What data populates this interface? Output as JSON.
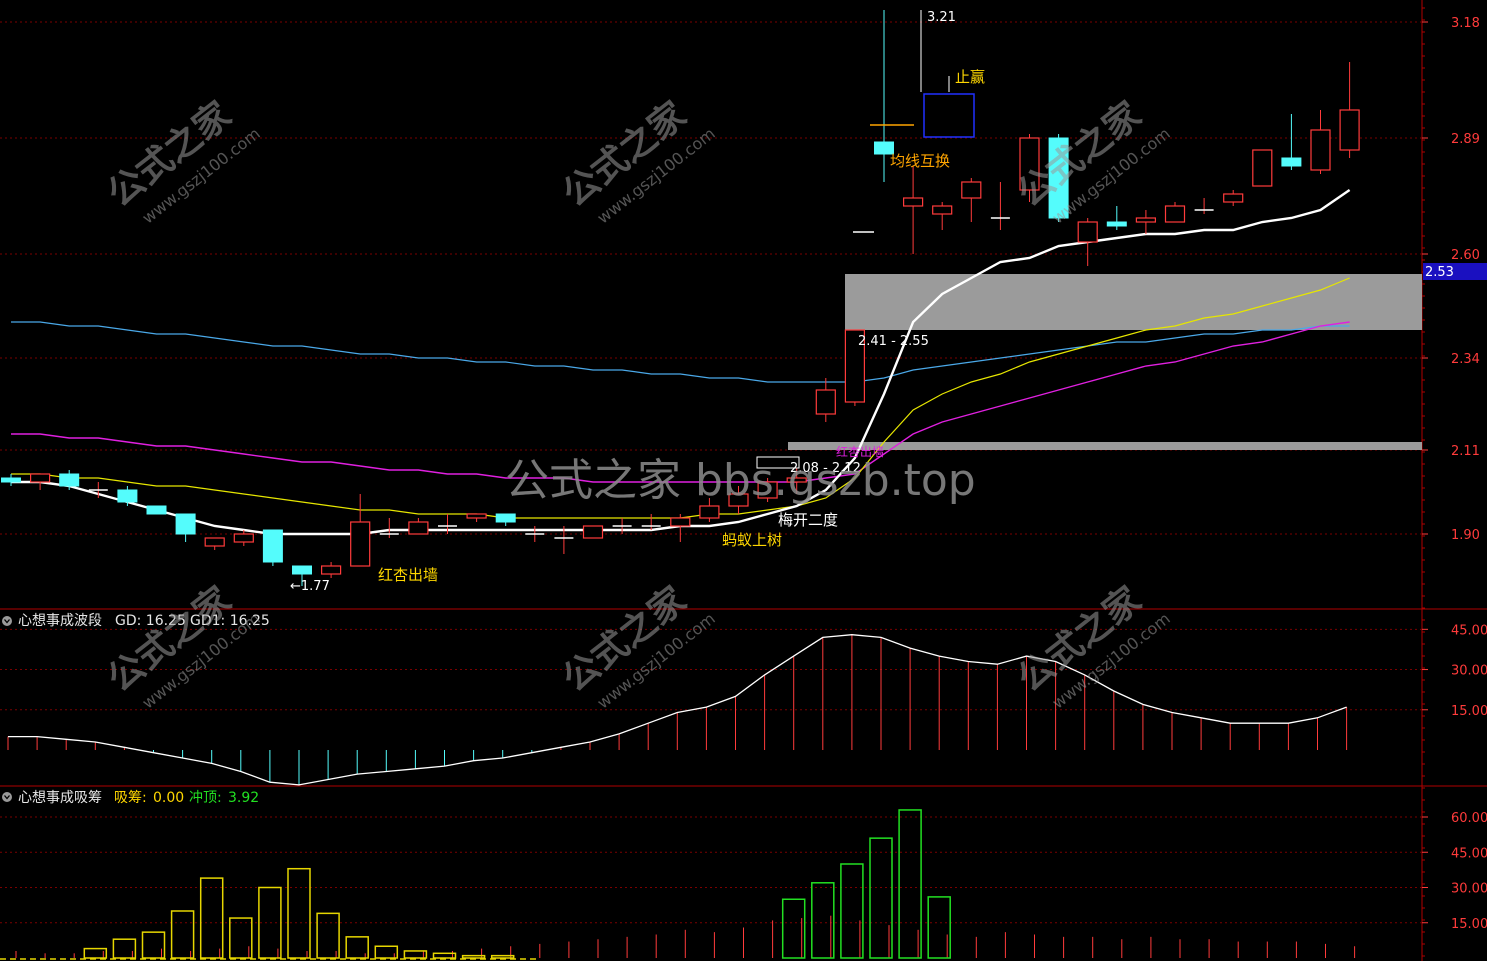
{
  "colors": {
    "background": "#000000",
    "up": "#ff3b3b",
    "down": "#54fcfc",
    "grid": "#7a0000",
    "frame": "#b00000",
    "axis_text": "#ff3b3b",
    "ma_fast": "#ffffff",
    "ma_yellow": "#e6e600",
    "ma_magenta": "#e020e0",
    "ma_blue": "#4aa8e8",
    "zone": "#a8a8a8",
    "yellow_label": "#ffd700",
    "orange_label": "#ffa500",
    "gd_line": "#ffffff",
    "wave_up": "#ff3b3b",
    "wave_down": "#54fcfc",
    "xc_bar": "#e6d600",
    "ct_bar": "#22e022",
    "sub_red": "#ff3b3b",
    "price_tag_bg": "#1a10c0"
  },
  "watermarks": {
    "center": "公式之家 bbs.gszb.top",
    "stamp_cn": "公式之家",
    "stamp_url": "www.gszj100.com"
  },
  "main_panel": {
    "price_axis_ticks": [
      "3.18",
      "2.89",
      "2.60",
      "2.34",
      "2.11",
      "1.90"
    ],
    "current_price_tag": "2.53",
    "annotations": {
      "high": "3.21",
      "low": "←1.77",
      "zone_upper": "2.41 - 2.55",
      "zone_lower": "2.08 - 2.12",
      "hong_xing": "红杏出墙",
      "ma_yi": "蚂蚁上树",
      "mei_kai": "梅开二度",
      "jun_xian": "均线互换",
      "zhi_ying": "止赢",
      "magenta_small": "红杏出墙"
    }
  },
  "wave_panel": {
    "title": "心想事成波段",
    "gd_label": "GD: 16.25",
    "gd1_label": "GD1: 16.25",
    "axis_ticks": [
      "45.00",
      "30.00",
      "15.00"
    ]
  },
  "xichou_panel": {
    "title": "心想事成吸筹",
    "xc_label": "吸筹:",
    "xc_value": "0.00",
    "ct_label": "冲顶:",
    "ct_value": "3.92",
    "axis_ticks": [
      "60.00",
      "45.00",
      "30.00",
      "15.00"
    ]
  },
  "chart_data": [
    {
      "type": "candlestick",
      "y_axis_ticks": [
        3.18,
        2.89,
        2.6,
        2.34,
        2.11,
        1.9
      ],
      "ylim": [
        1.73,
        3.27
      ],
      "candles": [
        {
          "o": 2.04,
          "h": 2.05,
          "l": 2.02,
          "c": 2.03
        },
        {
          "o": 2.03,
          "h": 2.05,
          "l": 2.01,
          "c": 2.05
        },
        {
          "o": 2.05,
          "h": 2.06,
          "l": 2.01,
          "c": 2.02
        },
        {
          "o": 2.01,
          "h": 2.03,
          "l": 1.99,
          "c": 2.01
        },
        {
          "o": 2.01,
          "h": 2.02,
          "l": 1.97,
          "c": 1.98
        },
        {
          "o": 1.97,
          "h": 1.97,
          "l": 1.95,
          "c": 1.95
        },
        {
          "o": 1.95,
          "h": 1.95,
          "l": 1.88,
          "c": 1.9
        },
        {
          "o": 1.87,
          "h": 1.89,
          "l": 1.86,
          "c": 1.89
        },
        {
          "o": 1.88,
          "h": 1.91,
          "l": 1.87,
          "c": 1.9
        },
        {
          "o": 1.91,
          "h": 1.91,
          "l": 1.82,
          "c": 1.83
        },
        {
          "o": 1.82,
          "h": 1.82,
          "l": 1.77,
          "c": 1.8
        },
        {
          "o": 1.8,
          "h": 1.83,
          "l": 1.79,
          "c": 1.82
        },
        {
          "o": 1.82,
          "h": 2.0,
          "l": 1.82,
          "c": 1.93
        },
        {
          "o": 1.9,
          "h": 1.94,
          "l": 1.89,
          "c": 1.9
        },
        {
          "o": 1.9,
          "h": 1.94,
          "l": 1.9,
          "c": 1.93
        },
        {
          "o": 1.92,
          "h": 1.95,
          "l": 1.9,
          "c": 1.92
        },
        {
          "o": 1.94,
          "h": 1.95,
          "l": 1.93,
          "c": 1.95
        },
        {
          "o": 1.95,
          "h": 1.95,
          "l": 1.92,
          "c": 1.93
        },
        {
          "o": 1.9,
          "h": 1.92,
          "l": 1.88,
          "c": 1.9
        },
        {
          "o": 1.89,
          "h": 1.92,
          "l": 1.85,
          "c": 1.89
        },
        {
          "o": 1.89,
          "h": 1.92,
          "l": 1.89,
          "c": 1.92
        },
        {
          "o": 1.92,
          "h": 1.94,
          "l": 1.9,
          "c": 1.92
        },
        {
          "o": 1.92,
          "h": 1.95,
          "l": 1.91,
          "c": 1.92
        },
        {
          "o": 1.92,
          "h": 1.95,
          "l": 1.88,
          "c": 1.94
        },
        {
          "o": 1.94,
          "h": 1.99,
          "l": 1.93,
          "c": 1.97
        },
        {
          "o": 1.97,
          "h": 2.02,
          "l": 1.95,
          "c": 2.0
        },
        {
          "o": 1.99,
          "h": 2.04,
          "l": 1.98,
          "c": 2.03
        },
        {
          "o": 2.03,
          "h": 2.07,
          "l": 2.0,
          "c": 2.04
        },
        {
          "o": 2.2,
          "h": 2.29,
          "l": 2.18,
          "c": 2.26
        },
        {
          "o": 2.23,
          "h": 2.41,
          "l": 2.22,
          "c": 2.41
        },
        {
          "o": 2.88,
          "h": 3.21,
          "l": 2.78,
          "c": 2.85
        },
        {
          "o": 2.72,
          "h": 2.82,
          "l": 2.6,
          "c": 2.74
        },
        {
          "o": 2.7,
          "h": 2.73,
          "l": 2.66,
          "c": 2.72
        },
        {
          "o": 2.74,
          "h": 2.79,
          "l": 2.68,
          "c": 2.78
        },
        {
          "o": 2.69,
          "h": 2.78,
          "l": 2.66,
          "c": 2.69
        },
        {
          "o": 2.76,
          "h": 2.9,
          "l": 2.73,
          "c": 2.89
        },
        {
          "o": 2.89,
          "h": 2.9,
          "l": 2.68,
          "c": 2.69
        },
        {
          "o": 2.63,
          "h": 2.69,
          "l": 2.57,
          "c": 2.68
        },
        {
          "o": 2.68,
          "h": 2.72,
          "l": 2.66,
          "c": 2.67
        },
        {
          "o": 2.68,
          "h": 2.71,
          "l": 2.65,
          "c": 2.69
        },
        {
          "o": 2.68,
          "h": 2.73,
          "l": 2.68,
          "c": 2.72
        },
        {
          "o": 2.71,
          "h": 2.74,
          "l": 2.7,
          "c": 2.71
        },
        {
          "o": 2.73,
          "h": 2.76,
          "l": 2.72,
          "c": 2.75
        },
        {
          "o": 2.77,
          "h": 2.86,
          "l": 2.77,
          "c": 2.86
        },
        {
          "o": 2.84,
          "h": 2.95,
          "l": 2.81,
          "c": 2.82
        },
        {
          "o": 2.81,
          "h": 2.96,
          "l": 2.8,
          "c": 2.91
        },
        {
          "o": 2.86,
          "h": 3.08,
          "l": 2.84,
          "c": 2.96
        }
      ],
      "ma_white": [
        2.03,
        2.03,
        2.02,
        2.0,
        1.98,
        1.96,
        1.94,
        1.92,
        1.91,
        1.9,
        1.9,
        1.9,
        1.9,
        1.91,
        1.91,
        1.91,
        1.91,
        1.91,
        1.91,
        1.91,
        1.91,
        1.91,
        1.91,
        1.92,
        1.92,
        1.93,
        1.95,
        1.97,
        2.01,
        2.09,
        2.25,
        2.43,
        2.5,
        2.54,
        2.58,
        2.59,
        2.62,
        2.63,
        2.64,
        2.65,
        2.65,
        2.66,
        2.66,
        2.68,
        2.69,
        2.71,
        2.76
      ],
      "ma_yellow": [
        2.05,
        2.05,
        2.04,
        2.04,
        2.03,
        2.02,
        2.02,
        2.01,
        2.0,
        1.99,
        1.98,
        1.97,
        1.96,
        1.96,
        1.95,
        1.95,
        1.95,
        1.94,
        1.94,
        1.94,
        1.94,
        1.94,
        1.94,
        1.94,
        1.95,
        1.95,
        1.96,
        1.97,
        1.99,
        2.04,
        2.13,
        2.21,
        2.25,
        2.28,
        2.3,
        2.33,
        2.35,
        2.37,
        2.39,
        2.41,
        2.42,
        2.44,
        2.45,
        2.47,
        2.49,
        2.51,
        2.54
      ],
      "ma_magenta": [
        2.15,
        2.15,
        2.14,
        2.14,
        2.13,
        2.12,
        2.12,
        2.11,
        2.1,
        2.09,
        2.08,
        2.08,
        2.07,
        2.06,
        2.06,
        2.05,
        2.05,
        2.04,
        2.04,
        2.04,
        2.03,
        2.03,
        2.03,
        2.03,
        2.03,
        2.03,
        2.03,
        2.03,
        2.04,
        2.05,
        2.1,
        2.15,
        2.18,
        2.2,
        2.22,
        2.24,
        2.26,
        2.28,
        2.3,
        2.32,
        2.33,
        2.35,
        2.37,
        2.38,
        2.4,
        2.42,
        2.43
      ],
      "ma_blue": [
        2.43,
        2.43,
        2.42,
        2.42,
        2.41,
        2.4,
        2.4,
        2.39,
        2.38,
        2.37,
        2.37,
        2.36,
        2.35,
        2.35,
        2.34,
        2.34,
        2.33,
        2.33,
        2.32,
        2.32,
        2.31,
        2.31,
        2.3,
        2.3,
        2.29,
        2.29,
        2.28,
        2.28,
        2.28,
        2.28,
        2.29,
        2.31,
        2.32,
        2.33,
        2.34,
        2.35,
        2.36,
        2.37,
        2.38,
        2.38,
        2.39,
        2.4,
        2.4,
        2.41,
        2.41,
        2.42,
        2.42
      ],
      "zones": [
        {
          "low": 2.41,
          "high": 2.55,
          "start": 29
        },
        {
          "low": 2.11,
          "high": 2.13,
          "start": 27
        }
      ]
    },
    {
      "type": "bar+line",
      "name": "心想事成波段",
      "axis_ticks": [
        45.0,
        30.0,
        15.0
      ],
      "ylim": [
        -13,
        49
      ],
      "baseline": 0,
      "gd": [
        5,
        5,
        4,
        3,
        1,
        -1,
        -3,
        -5,
        -8,
        -12,
        -13,
        -11,
        -9,
        -8,
        -7,
        -6,
        -4,
        -3,
        -1,
        1,
        3,
        6,
        10,
        14,
        16,
        20,
        28,
        35,
        42,
        43,
        42,
        38,
        35,
        33,
        32,
        35,
        33,
        28,
        22,
        17,
        14,
        12,
        10,
        10,
        10,
        12,
        16
      ]
    },
    {
      "type": "bar",
      "name": "心想事成吸筹",
      "axis_ticks": [
        60.0,
        45.0,
        30.0,
        15.0
      ],
      "ylim": [
        0,
        66
      ],
      "xc": [
        0,
        0,
        0,
        4,
        8,
        11,
        20,
        34,
        17,
        30,
        38,
        19,
        9,
        5,
        3,
        2,
        1,
        1,
        0,
        0,
        0,
        0,
        0,
        0,
        0,
        0,
        0,
        0,
        0,
        0,
        0,
        0,
        0,
        0,
        0,
        0,
        0,
        0,
        0,
        0,
        0,
        0,
        0,
        0,
        0,
        0,
        0
      ],
      "ct": [
        0,
        0,
        0,
        0,
        0,
        0,
        0,
        0,
        0,
        0,
        0,
        0,
        0,
        0,
        0,
        0,
        0,
        0,
        0,
        0,
        0,
        0,
        0,
        0,
        0,
        0,
        0,
        25,
        32,
        40,
        51,
        63,
        26,
        0,
        0,
        0,
        0,
        0,
        0,
        0,
        0,
        0,
        0,
        0,
        0,
        0,
        0
      ],
      "red_thin": [
        3,
        2,
        2,
        3,
        3,
        4,
        3,
        4,
        5,
        4,
        3,
        3,
        2,
        2,
        3,
        3,
        4,
        5,
        6,
        7,
        8,
        9,
        10,
        12,
        11,
        13,
        16,
        17,
        18,
        16,
        14,
        12,
        10,
        9,
        11,
        10,
        9,
        9,
        8,
        9,
        8,
        8,
        7,
        7,
        7,
        6,
        5
      ]
    }
  ]
}
